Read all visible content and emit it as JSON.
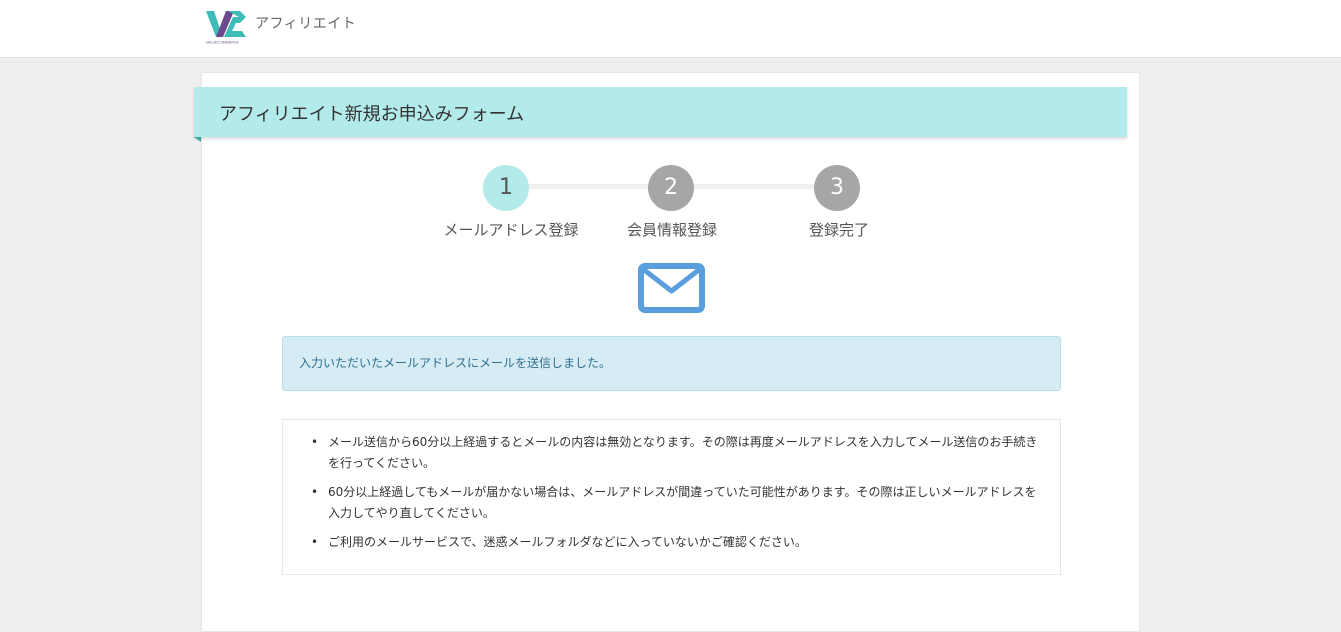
{
  "header": {
    "logo_icon": "valuecommerce-logo-icon",
    "logo_caption": "VALUECOMMERCE",
    "app_title": "アフィリエイト"
  },
  "form": {
    "title": "アフィリエイト新規お申込みフォーム"
  },
  "steps": [
    {
      "number": "1",
      "label": "メールアドレス登録",
      "state": "active"
    },
    {
      "number": "2",
      "label": "会員情報登録",
      "state": "inactive"
    },
    {
      "number": "3",
      "label": "登録完了",
      "state": "inactive"
    }
  ],
  "mail_icon": "envelope-icon",
  "alert": {
    "message": "入力いただいたメールアドレスにメールを送信しました。"
  },
  "notes": [
    "メール送信から60分以上経過するとメールの内容は無効となります。その際は再度メールアドレスを入力してメール送信のお手続きを行ってください。",
    "60分以上経過してもメールが届かない場合は、メールアドレスが間違っていた可能性があります。その際は正しいメールアドレスを入力してやり直してください。",
    "ご利用のメールサービスで、迷惑メールフォルダなどに入っていないかご確認ください。"
  ],
  "colors": {
    "accent": "#b2ebe9",
    "accent_dark": "#3aa59f",
    "step_inactive": "#a6a6a6",
    "mail_icon": "#5a9fdd",
    "alert_bg": "#d6ecf4",
    "alert_text": "#31708f",
    "logo_teal": "#3dbcb8",
    "logo_purple": "#6b4a8f"
  }
}
